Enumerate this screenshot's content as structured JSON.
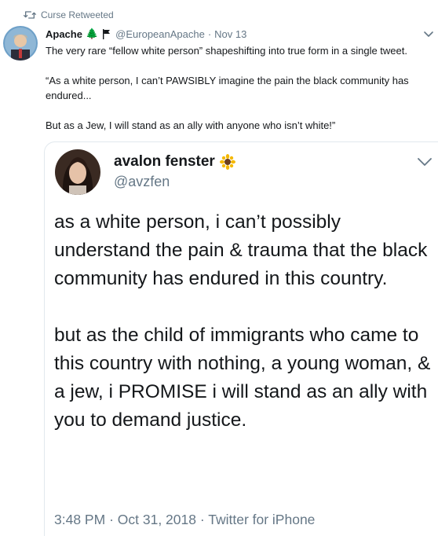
{
  "retweet": {
    "icon": "retweet-icon",
    "label": "Curse Retweeted"
  },
  "tweet": {
    "author_name": "Apache",
    "author_emoji": "🌲",
    "flag_icon": "flag-icon",
    "handle": "@EuropeanApache",
    "separator": "·",
    "date": "Nov 13",
    "text": {
      "line1": "The very rare “fellow white person” shapeshifting into true form in a single tweet.",
      "line2": "“As a white person, I can’t PAWSIBLY imagine the pain the black community has endured...",
      "line3": "But as a Jew, I will stand as an ally with anyone who isn’t white!”"
    }
  },
  "quoted_tweet": {
    "author_name": "avalon fenster",
    "author_emoji_icon": "sunflower-icon",
    "handle": "@avzfen",
    "text": {
      "para1": "as a white person, i can’t possibly understand the pain & trauma that the black community has endured in this country.",
      "para2": "but as the child of immigrants who came to this country with nothing, a young woman, & a jew, i PROMISE i will stand as an ally with you to demand justice."
    },
    "time": "3:48 PM",
    "separator1": "·",
    "date": "Oct 31, 2018",
    "separator2": "·",
    "source": "Twitter for iPhone"
  },
  "colors": {
    "text_primary": "#14171a",
    "text_secondary": "#657786",
    "border": "#e1e8ed"
  }
}
